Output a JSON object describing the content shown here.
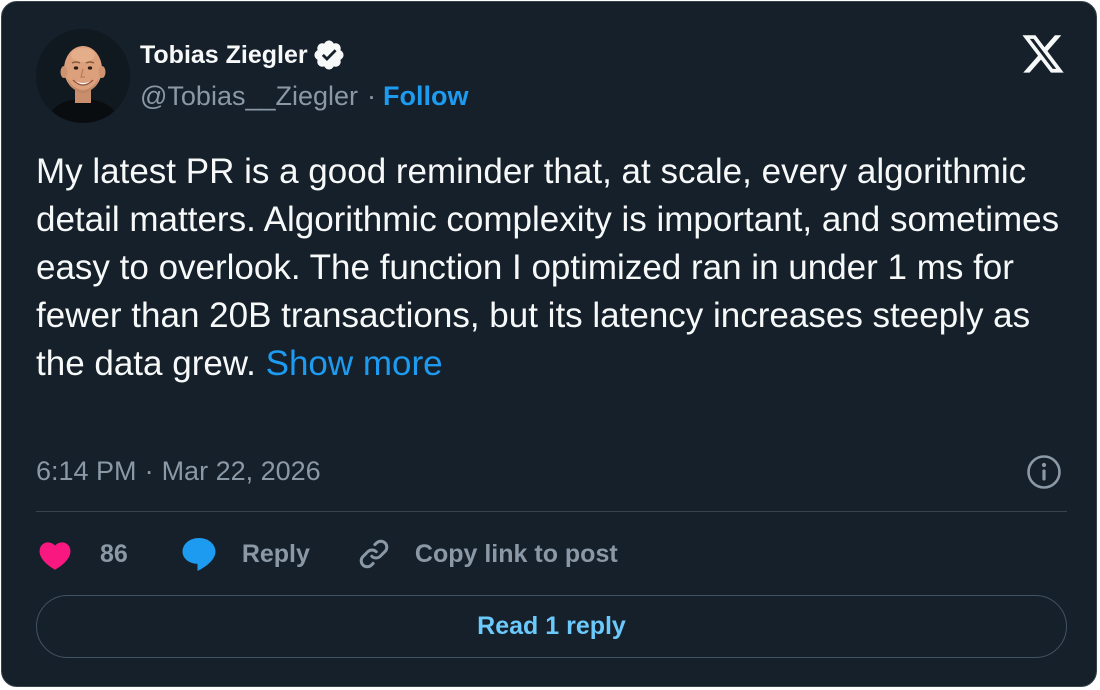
{
  "author": {
    "display_name": "Tobias Ziegler",
    "handle": "@Tobias__Ziegler",
    "separator": "·",
    "follow_label": "Follow",
    "verified_icon": "verified-badge-icon"
  },
  "brand_icon": "x-logo-icon",
  "tweet": {
    "text": "My latest PR is a good reminder that, at scale, every algorithmic detail matters. Algorithmic complexity is important, and sometimes easy to overlook. The function I optimized ran in under 1 ms for fewer than 20B transactions, but its latency increases steeply as the data grew.",
    "show_more_label": "Show more"
  },
  "meta": {
    "time": "6:14 PM",
    "separator": "·",
    "date": "Mar 22, 2026",
    "info_icon": "info-icon"
  },
  "actions": {
    "like_icon": "heart-icon",
    "like_count": "86",
    "reply_icon": "speech-bubble-icon",
    "reply_label": "Reply",
    "copy_icon": "link-icon",
    "copy_label": "Copy link to post"
  },
  "read_replies_label": "Read 1 reply",
  "colors": {
    "background": "#15202b",
    "border": "#38444d",
    "text_primary": "#f7f9f9",
    "text_secondary": "#8b98a5",
    "accent_blue": "#1d9bf0",
    "like_pink": "#f91880",
    "read_reply_text": "#6bc9fb"
  }
}
